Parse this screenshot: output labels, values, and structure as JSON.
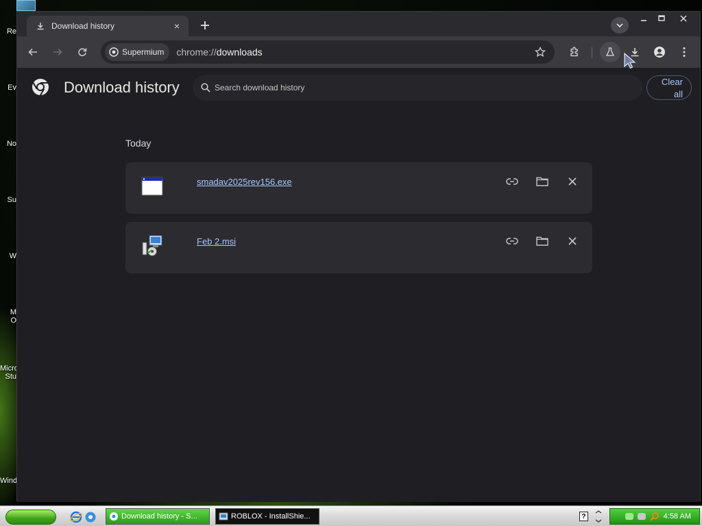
{
  "desktop": {
    "icon_labels": [
      "Re",
      "Ev",
      "No",
      "Su",
      "W",
      "M",
      "O",
      "Micro",
      "Stu",
      "Wind"
    ]
  },
  "browser": {
    "tab": {
      "title": "Download history",
      "close_symbol": "×"
    },
    "new_tab_symbol": "+",
    "window_controls": {
      "minimize": "–",
      "maximize": "☐",
      "close": "✕"
    },
    "omnibox": {
      "chip_label": "Supermium",
      "url_scheme": "chrome://",
      "url_host": "downloads"
    }
  },
  "page": {
    "title": "Download history",
    "search": {
      "placeholder": "Search download history",
      "value": ""
    },
    "clear_all_label": "Clear\nall",
    "section_label": "Today",
    "downloads": [
      {
        "file_name": "smadav2025rev156.exe",
        "icon": "exe-window-icon"
      },
      {
        "file_name": "Feb 2.msi",
        "icon": "msi-installer-icon"
      }
    ]
  },
  "taskbar": {
    "tasks": [
      {
        "label": "Download history - S...",
        "active": true
      },
      {
        "label": "ROBLOX - InstallShie...",
        "active": false
      }
    ],
    "help_symbol": "?",
    "clock": "4:58 AM"
  },
  "colors": {
    "page_bg": "#1f1f23",
    "card_bg": "#2b2b30",
    "link": "#a8c7fa",
    "taskbar_green": "#2d9a1c"
  }
}
